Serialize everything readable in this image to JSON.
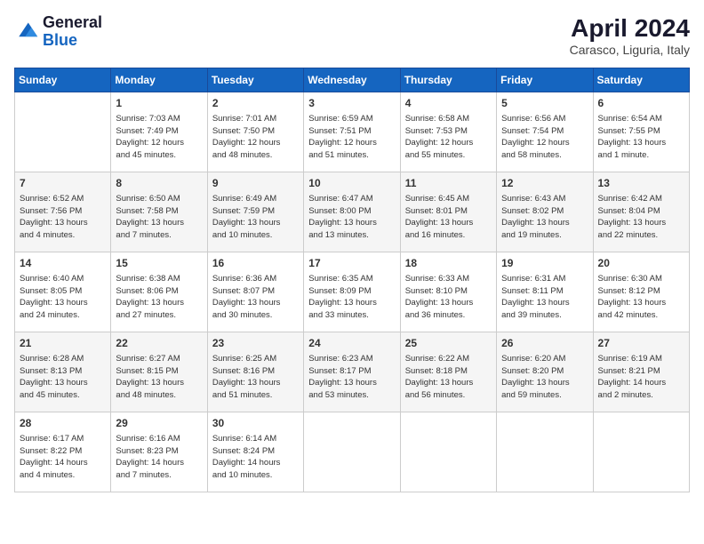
{
  "header": {
    "logo_general": "General",
    "logo_blue": "Blue",
    "title": "April 2024",
    "location": "Carasco, Liguria, Italy"
  },
  "calendar": {
    "weekdays": [
      "Sunday",
      "Monday",
      "Tuesday",
      "Wednesday",
      "Thursday",
      "Friday",
      "Saturday"
    ],
    "weeks": [
      [
        {
          "day": "",
          "detail": ""
        },
        {
          "day": "1",
          "detail": "Sunrise: 7:03 AM\nSunset: 7:49 PM\nDaylight: 12 hours\nand 45 minutes."
        },
        {
          "day": "2",
          "detail": "Sunrise: 7:01 AM\nSunset: 7:50 PM\nDaylight: 12 hours\nand 48 minutes."
        },
        {
          "day": "3",
          "detail": "Sunrise: 6:59 AM\nSunset: 7:51 PM\nDaylight: 12 hours\nand 51 minutes."
        },
        {
          "day": "4",
          "detail": "Sunrise: 6:58 AM\nSunset: 7:53 PM\nDaylight: 12 hours\nand 55 minutes."
        },
        {
          "day": "5",
          "detail": "Sunrise: 6:56 AM\nSunset: 7:54 PM\nDaylight: 12 hours\nand 58 minutes."
        },
        {
          "day": "6",
          "detail": "Sunrise: 6:54 AM\nSunset: 7:55 PM\nDaylight: 13 hours\nand 1 minute."
        }
      ],
      [
        {
          "day": "7",
          "detail": "Sunrise: 6:52 AM\nSunset: 7:56 PM\nDaylight: 13 hours\nand 4 minutes."
        },
        {
          "day": "8",
          "detail": "Sunrise: 6:50 AM\nSunset: 7:58 PM\nDaylight: 13 hours\nand 7 minutes."
        },
        {
          "day": "9",
          "detail": "Sunrise: 6:49 AM\nSunset: 7:59 PM\nDaylight: 13 hours\nand 10 minutes."
        },
        {
          "day": "10",
          "detail": "Sunrise: 6:47 AM\nSunset: 8:00 PM\nDaylight: 13 hours\nand 13 minutes."
        },
        {
          "day": "11",
          "detail": "Sunrise: 6:45 AM\nSunset: 8:01 PM\nDaylight: 13 hours\nand 16 minutes."
        },
        {
          "day": "12",
          "detail": "Sunrise: 6:43 AM\nSunset: 8:02 PM\nDaylight: 13 hours\nand 19 minutes."
        },
        {
          "day": "13",
          "detail": "Sunrise: 6:42 AM\nSunset: 8:04 PM\nDaylight: 13 hours\nand 22 minutes."
        }
      ],
      [
        {
          "day": "14",
          "detail": "Sunrise: 6:40 AM\nSunset: 8:05 PM\nDaylight: 13 hours\nand 24 minutes."
        },
        {
          "day": "15",
          "detail": "Sunrise: 6:38 AM\nSunset: 8:06 PM\nDaylight: 13 hours\nand 27 minutes."
        },
        {
          "day": "16",
          "detail": "Sunrise: 6:36 AM\nSunset: 8:07 PM\nDaylight: 13 hours\nand 30 minutes."
        },
        {
          "day": "17",
          "detail": "Sunrise: 6:35 AM\nSunset: 8:09 PM\nDaylight: 13 hours\nand 33 minutes."
        },
        {
          "day": "18",
          "detail": "Sunrise: 6:33 AM\nSunset: 8:10 PM\nDaylight: 13 hours\nand 36 minutes."
        },
        {
          "day": "19",
          "detail": "Sunrise: 6:31 AM\nSunset: 8:11 PM\nDaylight: 13 hours\nand 39 minutes."
        },
        {
          "day": "20",
          "detail": "Sunrise: 6:30 AM\nSunset: 8:12 PM\nDaylight: 13 hours\nand 42 minutes."
        }
      ],
      [
        {
          "day": "21",
          "detail": "Sunrise: 6:28 AM\nSunset: 8:13 PM\nDaylight: 13 hours\nand 45 minutes."
        },
        {
          "day": "22",
          "detail": "Sunrise: 6:27 AM\nSunset: 8:15 PM\nDaylight: 13 hours\nand 48 minutes."
        },
        {
          "day": "23",
          "detail": "Sunrise: 6:25 AM\nSunset: 8:16 PM\nDaylight: 13 hours\nand 51 minutes."
        },
        {
          "day": "24",
          "detail": "Sunrise: 6:23 AM\nSunset: 8:17 PM\nDaylight: 13 hours\nand 53 minutes."
        },
        {
          "day": "25",
          "detail": "Sunrise: 6:22 AM\nSunset: 8:18 PM\nDaylight: 13 hours\nand 56 minutes."
        },
        {
          "day": "26",
          "detail": "Sunrise: 6:20 AM\nSunset: 8:20 PM\nDaylight: 13 hours\nand 59 minutes."
        },
        {
          "day": "27",
          "detail": "Sunrise: 6:19 AM\nSunset: 8:21 PM\nDaylight: 14 hours\nand 2 minutes."
        }
      ],
      [
        {
          "day": "28",
          "detail": "Sunrise: 6:17 AM\nSunset: 8:22 PM\nDaylight: 14 hours\nand 4 minutes."
        },
        {
          "day": "29",
          "detail": "Sunrise: 6:16 AM\nSunset: 8:23 PM\nDaylight: 14 hours\nand 7 minutes."
        },
        {
          "day": "30",
          "detail": "Sunrise: 6:14 AM\nSunset: 8:24 PM\nDaylight: 14 hours\nand 10 minutes."
        },
        {
          "day": "",
          "detail": ""
        },
        {
          "day": "",
          "detail": ""
        },
        {
          "day": "",
          "detail": ""
        },
        {
          "day": "",
          "detail": ""
        }
      ]
    ]
  }
}
